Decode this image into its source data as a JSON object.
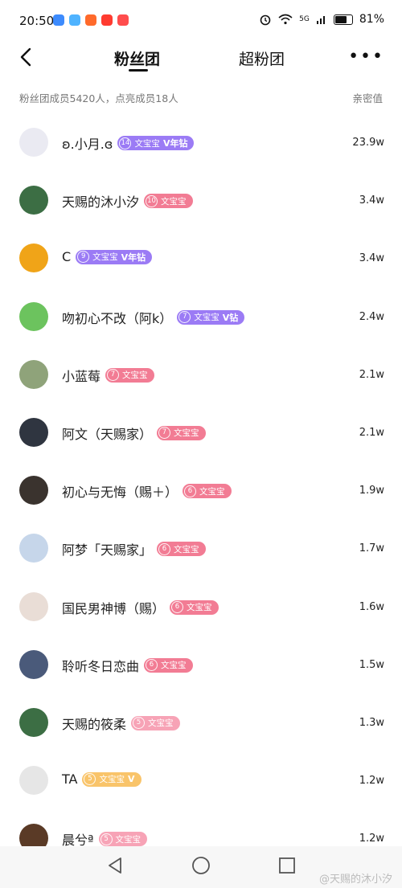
{
  "status_bar": {
    "time": "20:50",
    "signal": "5G",
    "battery": "81%",
    "battery_level": 0.81,
    "apps": [
      {
        "icon": "blue-app-icon",
        "color": "#3d8bfd"
      },
      {
        "icon": "bird-app-icon",
        "color": "#4fb3ff"
      },
      {
        "icon": "taobao-icon",
        "color": "#ff6a2b"
      },
      {
        "icon": "red-app-icon",
        "color": "#ff3b30"
      },
      {
        "icon": "book-app-icon",
        "color": "#ff4d4d"
      }
    ]
  },
  "header": {
    "tab_active": "粉丝团",
    "tab_other": "超粉团",
    "more": "•••"
  },
  "summary": {
    "text": "粉丝团成员5420人，点亮成员18人",
    "right": "亲密值"
  },
  "badge_text": "文宝宝",
  "members": [
    {
      "name": "ʚ.小月.ɞ",
      "level": "14",
      "extra": "V年钻",
      "badge_color": "#9b7bf5",
      "value": "23.9w",
      "avatar_color": "#eaeaf2"
    },
    {
      "name": "天赐的沐小汐",
      "level": "10",
      "extra": "",
      "badge_color": "#f27c94",
      "value": "3.4w",
      "avatar_color": "#3c6e44"
    },
    {
      "name": "C",
      "level": "9",
      "extra": "V年钻",
      "badge_color": "#9b7bf5",
      "value": "3.4w",
      "avatar_color": "#f0a418"
    },
    {
      "name": "吻初心不改（阿k）",
      "level": "7",
      "extra": "V钻",
      "badge_color": "#9b7bf5",
      "value": "2.4w",
      "avatar_color": "#6cc35e"
    },
    {
      "name": "小蓝莓",
      "level": "7",
      "extra": "",
      "badge_color": "#f27c94",
      "value": "2.1w",
      "avatar_color": "#8fa37a"
    },
    {
      "name": "阿文（天赐家）",
      "level": "7",
      "extra": "",
      "badge_color": "#f27c94",
      "value": "2.1w",
      "avatar_color": "#2f3540"
    },
    {
      "name": "初心与无悔（赐＋）",
      "level": "6",
      "extra": "",
      "badge_color": "#f27c94",
      "value": "1.9w",
      "avatar_color": "#3a332e"
    },
    {
      "name": "阿梦「天赐家」",
      "level": "6",
      "extra": "",
      "badge_color": "#f27c94",
      "value": "1.7w",
      "avatar_color": "#c6d6ea"
    },
    {
      "name": "国民男神博（赐）",
      "level": "6",
      "extra": "",
      "badge_color": "#f27c94",
      "value": "1.6w",
      "avatar_color": "#e9ddd6"
    },
    {
      "name": "聆听冬日恋曲",
      "level": "6",
      "extra": "",
      "badge_color": "#f27c94",
      "value": "1.5w",
      "avatar_color": "#4a5a7a"
    },
    {
      "name": "天赐的筱柔",
      "level": "5",
      "extra": "",
      "badge_color": "#f7a3b6",
      "value": "1.3w",
      "avatar_color": "#3c6e44"
    },
    {
      "name": "TA",
      "level": "5",
      "extra": "V",
      "badge_color": "#f9c46a",
      "value": "1.2w",
      "avatar_color": "#e6e6e6"
    },
    {
      "name": "晨兮ª",
      "level": "5",
      "extra": "",
      "badge_color": "#f7a3b6",
      "value": "1.2w",
      "avatar_color": "#5a3a26"
    }
  ],
  "watermark": "@天赐的沐小汐"
}
